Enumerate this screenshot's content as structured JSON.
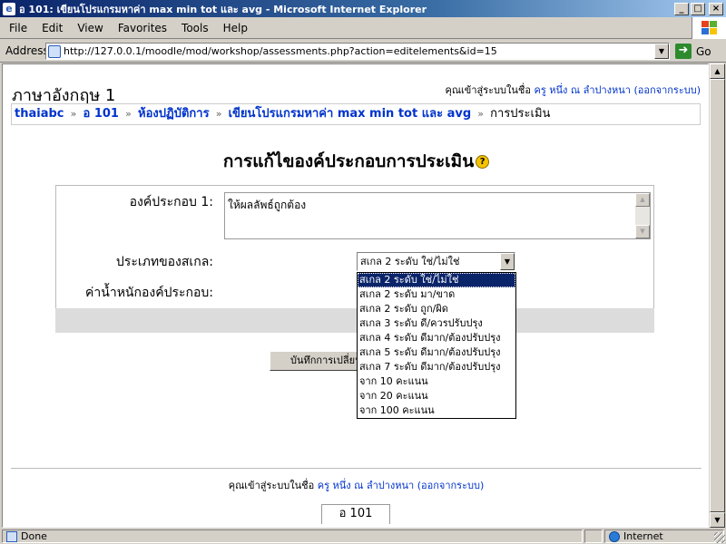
{
  "window": {
    "title": "อ 101: เขียนโปรแกรมหาค่า max min tot และ avg - Microsoft Internet Explorer",
    "minimize": "_",
    "maximize": "□",
    "close": "×"
  },
  "menu": [
    "File",
    "Edit",
    "View",
    "Favorites",
    "Tools",
    "Help"
  ],
  "address": {
    "label": "Address",
    "url": "http://127.0.0.1/moodle/mod/workshop/assessments.php?action=editelements&id=15",
    "go_label": "Go"
  },
  "page": {
    "course_title": "ภาษาอังกฤษ 1",
    "login_prefix": "คุณเข้าสู่ระบบในชื่อ",
    "user_name": "ครู หนึ่ง ณ ลำปางหนา",
    "logout": "(ออกจากระบบ)",
    "breadcrumb": {
      "site": "thaiabc",
      "course": "อ 101",
      "workshops": "ห้องปฏิบัติการ",
      "workshop": "เขียนโปรแกรมหาค่า max min tot และ avg",
      "current": "การประเมิน",
      "separator": "»"
    },
    "heading": "การแก้ไของค์ประกอบการประเมิน",
    "help_glyph": "?",
    "form": {
      "element_label": "องค์ประกอบ 1:",
      "element_value": "ให้ผลลัพธ์ถูกต้อง",
      "scale_label": "ประเภทของสเกล:",
      "scale_selected": "สเกล 2 ระดับ ใช่/ไม่ใช่",
      "weight_label": "ค่าน้ำหนักองค์ประกอบ:",
      "save_button": "บันทึกการเปลี่ยนแปลง"
    },
    "scale_options": [
      "สเกล 2 ระดับ ใช่/ไม่ใช่",
      "สเกล 2 ระดับ มา/ขาด",
      "สเกล 2 ระดับ ถูก/ผิด",
      "สเกล 3 ระดับ ดี/ควรปรับปรุง",
      "สเกล 4 ระดับ ดีมาก/ต้องปรับปรุง",
      "สเกล 5 ระดับ ดีมาก/ต้องปรับปรุง",
      "สเกล 7 ระดับ ดีมาก/ต้องปรับปรุง",
      "จาก 10 คะแนน",
      "จาก 20 คะแนน",
      "จาก 100 คะแนน"
    ],
    "footer_course_tab": "อ 101"
  },
  "status": {
    "text": "Done",
    "zone": "Internet"
  },
  "colors": {
    "link": "#0033cc",
    "titlebar": "#0a246a",
    "selected_option": "#0a246a",
    "form_footer": "#dcdcdc"
  }
}
